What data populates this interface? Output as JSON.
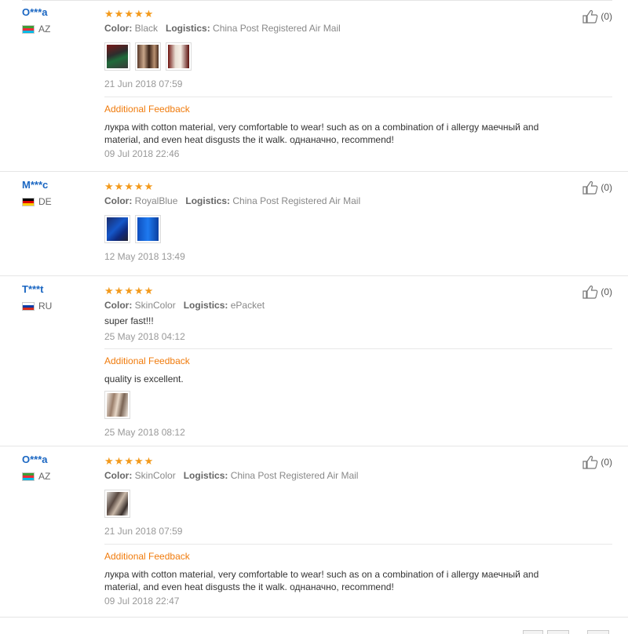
{
  "reviews": [
    {
      "user": "O***a",
      "country": "AZ",
      "color_label": "Color:",
      "color": "Black",
      "logistics_label": "Logistics:",
      "logistics": "China Post Registered Air Mail",
      "date": "21 Jun 2018 07:59",
      "likes": "(0)",
      "feedback_title": "Additional Feedback",
      "feedback_text_1": "лукра with cotton material, very comfortable to wear! such as on a combination of i allergy маечный and",
      "feedback_text_2": "material, and even heat disgusts the it walk. однаначно, recommend!",
      "feedback_date": "09 Jul 2018 22:46"
    },
    {
      "user": "M***c",
      "country": "DE",
      "color_label": "Color:",
      "color": "RoyalBlue",
      "logistics_label": "Logistics:",
      "logistics": "China Post Registered Air Mail",
      "date": "12 May 2018 13:49",
      "likes": "(0)"
    },
    {
      "user": "T***t",
      "country": "RU",
      "color_label": "Color:",
      "color": "SkinColor",
      "logistics_label": "Logistics:",
      "logistics": "ePacket",
      "text": "super fast!!!",
      "date": "25 May 2018 04:12",
      "likes": "(0)",
      "feedback_title": "Additional Feedback",
      "feedback_text_1": "quality is excellent.",
      "feedback_date": "25 May 2018 08:12"
    },
    {
      "user": "O***a",
      "country": "AZ",
      "color_label": "Color:",
      "color": "SkinColor",
      "logistics_label": "Logistics:",
      "logistics": "China Post Registered Air Mail",
      "date": "21 Jun 2018 07:59",
      "likes": "(0)",
      "feedback_title": "Additional Feedback",
      "feedback_text_1": "лукра with cotton material, very comfortable to wear! such as on a combination of i allergy маечный and",
      "feedback_text_2": "material, and even heat disgusts the it walk. однаначно, recommend!",
      "feedback_date": "09 Jul 2018 22:47"
    }
  ],
  "rating_stars": 5,
  "icons": {
    "star": "star-icon",
    "like": "thumbs-up-icon"
  },
  "colors": {
    "username": "#1a66c2",
    "star": "#f39a1c",
    "feedback_title": "#f07b0c"
  }
}
